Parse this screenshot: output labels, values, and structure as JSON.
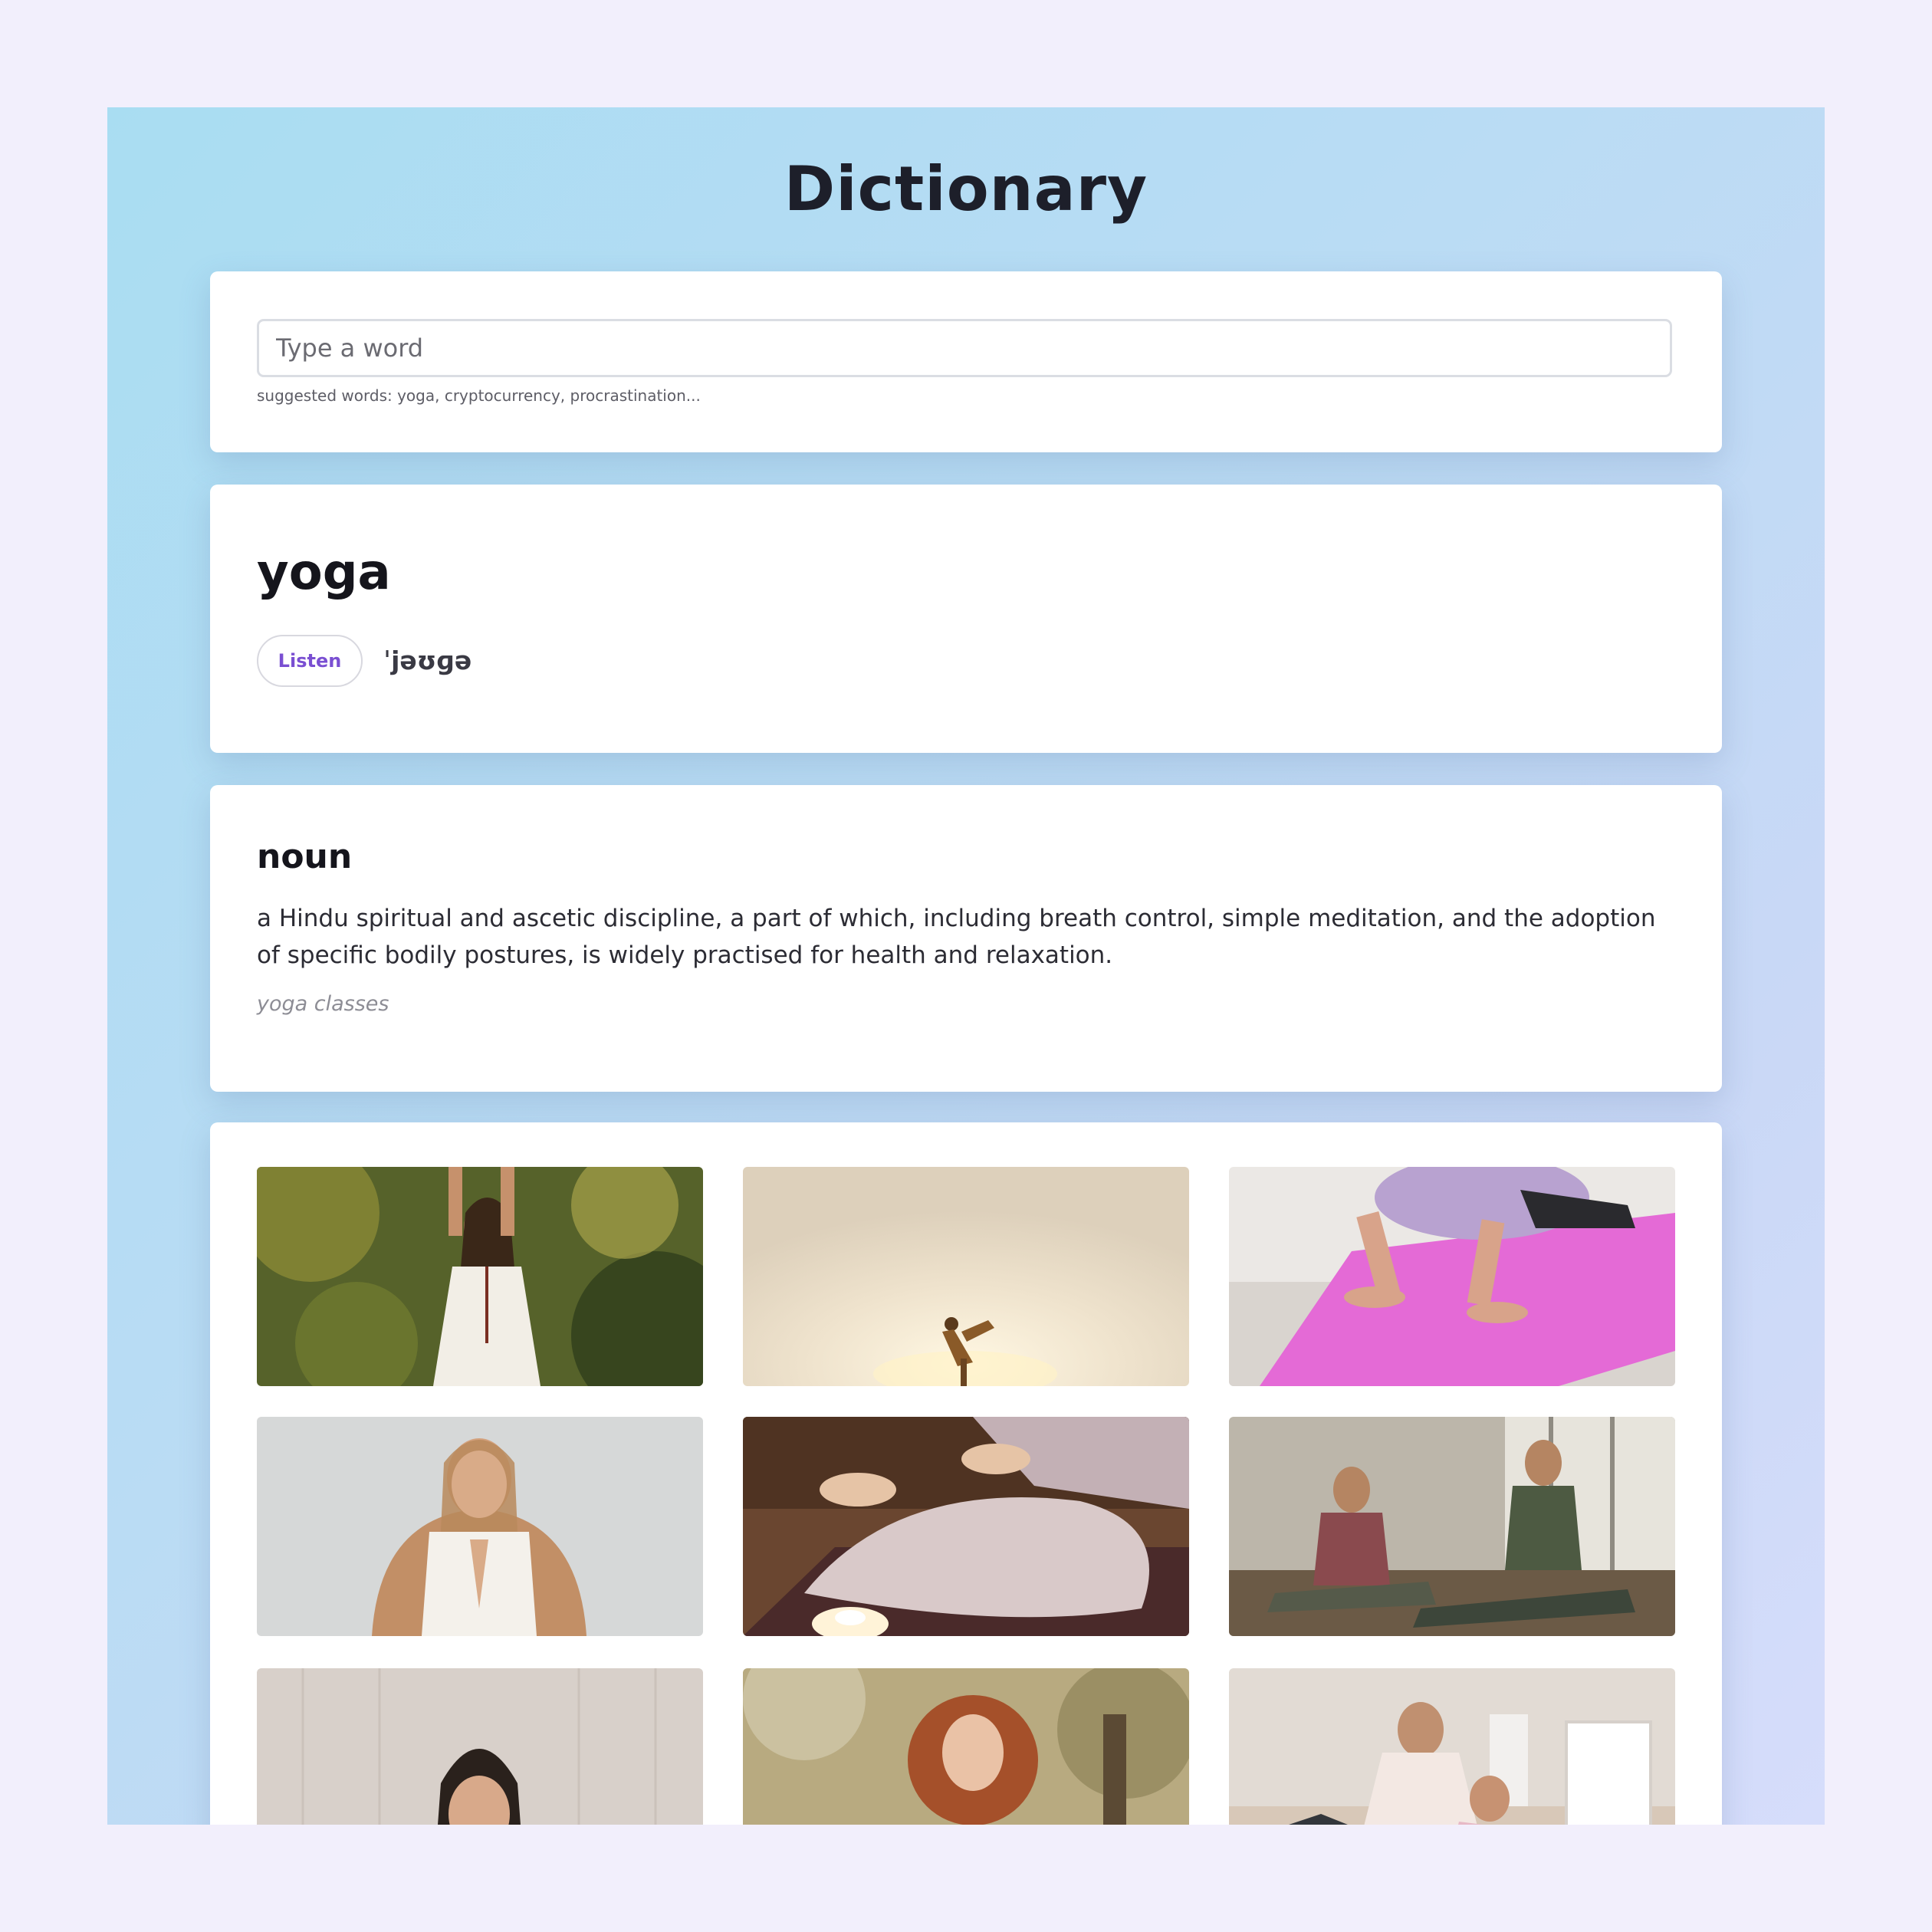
{
  "app": {
    "title": "Dictionary"
  },
  "search": {
    "placeholder": "Type a word",
    "value": "",
    "hint": "suggested words: yoga, cryptocurrency, procrastination..."
  },
  "word": {
    "text": "yoga",
    "listen_label": "Listen",
    "phonetic": "ˈjəʊɡə"
  },
  "meaning": {
    "part_of_speech": "noun",
    "definition": "a Hindu spiritual and ascetic discipline, a part of which, including breath control, simple meditation, and the adoption of specific bodily postures, is widely practised for health and relaxation.",
    "example": "yoga classes"
  },
  "photos": [
    {
      "subject": "woman-arms-raised-forest",
      "colors": [
        "#5f6b2c",
        "#a3a044",
        "#f1ede4"
      ]
    },
    {
      "subject": "silhouette-pose-sunrise",
      "colors": [
        "#f5ecde",
        "#ece0c8",
        "#d69a4e"
      ]
    },
    {
      "subject": "hands-on-pink-mat",
      "colors": [
        "#ece9e6",
        "#e86ad8",
        "#d49f84"
      ]
    },
    {
      "subject": "woman-namaste-white-wall",
      "colors": [
        "#d9dbdb",
        "#f3efe8",
        "#c99569"
      ]
    },
    {
      "subject": "meditation-hands-candle",
      "colors": [
        "#5e3b27",
        "#d7c7c5",
        "#f7e6cc"
      ]
    },
    {
      "subject": "two-women-stretching-studio",
      "colors": [
        "#bfb6a6",
        "#4e5a44",
        "#8a5656"
      ]
    },
    {
      "subject": "woman-meditating-wood-wall",
      "colors": [
        "#d7cfc9",
        "#2d2420",
        "#8a6bb8"
      ]
    },
    {
      "subject": "curly-hair-woman-outdoors",
      "colors": [
        "#b5a57b",
        "#a45228",
        "#f0ede8"
      ]
    },
    {
      "subject": "mother-child-yoga-home",
      "colors": [
        "#e1dad4",
        "#2f3136",
        "#f5e7e4"
      ]
    }
  ]
}
